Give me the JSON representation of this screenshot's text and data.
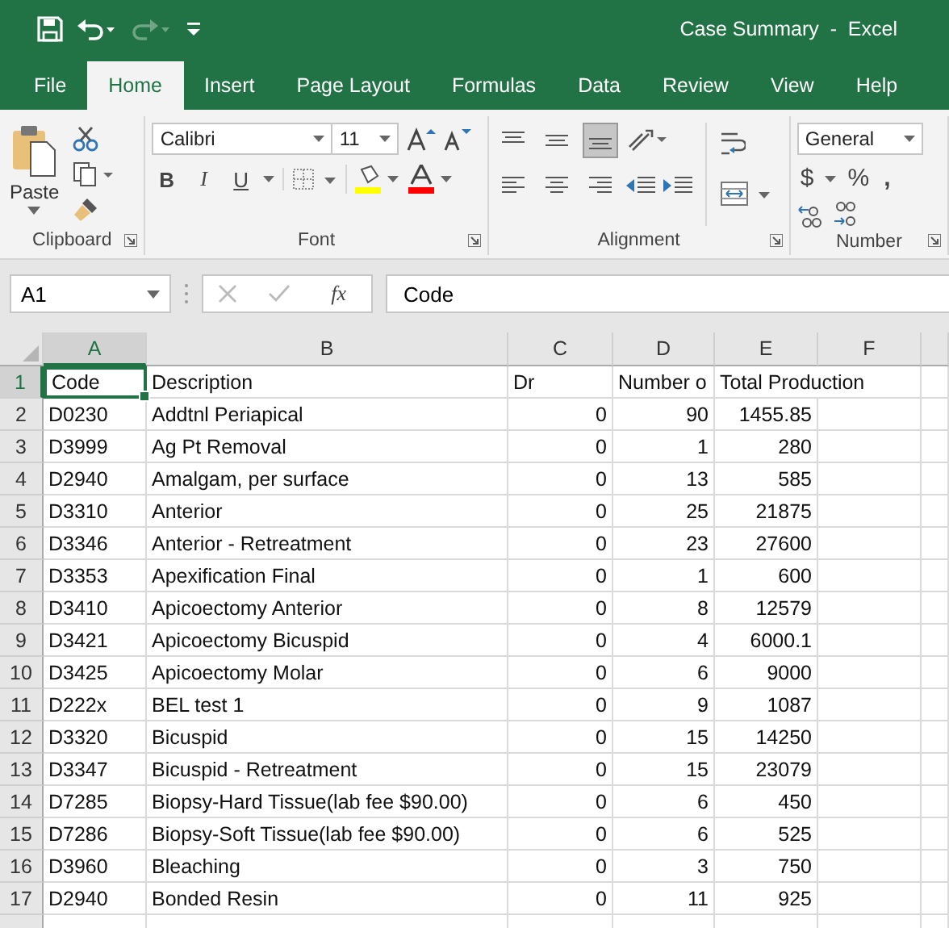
{
  "window": {
    "title": "Case Summary  -  Excel"
  },
  "tabs": [
    {
      "label": "File",
      "selected": false
    },
    {
      "label": "Home",
      "selected": true
    },
    {
      "label": "Insert",
      "selected": false
    },
    {
      "label": "Page Layout",
      "selected": false
    },
    {
      "label": "Formulas",
      "selected": false
    },
    {
      "label": "Data",
      "selected": false
    },
    {
      "label": "Review",
      "selected": false
    },
    {
      "label": "View",
      "selected": false
    },
    {
      "label": "Help",
      "selected": false
    }
  ],
  "ribbon": {
    "clipboard": {
      "label": "Clipboard",
      "paste": "Paste"
    },
    "font": {
      "label": "Font",
      "name": "Calibri",
      "size": "11",
      "bold": "B",
      "italic": "I",
      "underline": "U"
    },
    "alignment": {
      "label": "Alignment",
      "vertical": [
        {
          "kind": "top",
          "selected": false
        },
        {
          "kind": "middle",
          "selected": false
        },
        {
          "kind": "bottom",
          "selected": true
        }
      ],
      "horizontal": [
        {
          "kind": "left",
          "selected": false
        },
        {
          "kind": "center",
          "selected": false
        },
        {
          "kind": "right",
          "selected": false
        }
      ]
    },
    "number": {
      "label": "Number",
      "format": "General",
      "currency": "$",
      "percent": "%",
      "comma": ","
    }
  },
  "formula_bar": {
    "name_box": "A1",
    "fx": "fx",
    "value": "Code"
  },
  "columns": [
    {
      "label": "A",
      "selected": true
    },
    {
      "label": "B",
      "selected": false
    },
    {
      "label": "C",
      "selected": false
    },
    {
      "label": "D",
      "selected": false
    },
    {
      "label": "E",
      "selected": false
    },
    {
      "label": "F",
      "selected": false
    }
  ],
  "rows": [
    {
      "number": "1",
      "selected": true,
      "cells": [
        "Code",
        "Description",
        "Dr",
        "Number o",
        "Total Production",
        ""
      ]
    },
    {
      "number": "2",
      "selected": false,
      "cells": [
        "D0230",
        "Addtnl Periapical",
        "0",
        "90",
        "1455.85",
        ""
      ]
    },
    {
      "number": "3",
      "selected": false,
      "cells": [
        "D3999",
        "Ag Pt Removal",
        "0",
        "1",
        "280",
        ""
      ]
    },
    {
      "number": "4",
      "selected": false,
      "cells": [
        "D2940",
        "Amalgam, per surface",
        "0",
        "13",
        "585",
        ""
      ]
    },
    {
      "number": "5",
      "selected": false,
      "cells": [
        "D3310",
        "Anterior",
        "0",
        "25",
        "21875",
        ""
      ]
    },
    {
      "number": "6",
      "selected": false,
      "cells": [
        "D3346",
        "Anterior - Retreatment",
        "0",
        "23",
        "27600",
        ""
      ]
    },
    {
      "number": "7",
      "selected": false,
      "cells": [
        "D3353",
        "Apexification Final",
        "0",
        "1",
        "600",
        ""
      ]
    },
    {
      "number": "8",
      "selected": false,
      "cells": [
        "D3410",
        "Apicoectomy Anterior",
        "0",
        "8",
        "12579",
        ""
      ]
    },
    {
      "number": "9",
      "selected": false,
      "cells": [
        "D3421",
        "Apicoectomy Bicuspid",
        "0",
        "4",
        "6000.1",
        ""
      ]
    },
    {
      "number": "10",
      "selected": false,
      "cells": [
        "D3425",
        "Apicoectomy Molar",
        "0",
        "6",
        "9000",
        ""
      ]
    },
    {
      "number": "11",
      "selected": false,
      "cells": [
        "D222x",
        "BEL test 1",
        "0",
        "9",
        "1087",
        ""
      ]
    },
    {
      "number": "12",
      "selected": false,
      "cells": [
        "D3320",
        "Bicuspid",
        "0",
        "15",
        "14250",
        ""
      ]
    },
    {
      "number": "13",
      "selected": false,
      "cells": [
        "D3347",
        "Bicuspid - Retreatment",
        "0",
        "15",
        "23079",
        ""
      ]
    },
    {
      "number": "14",
      "selected": false,
      "cells": [
        "D7285",
        "Biopsy-Hard Tissue(lab fee $90.00)",
        "0",
        "6",
        "450",
        ""
      ]
    },
    {
      "number": "15",
      "selected": false,
      "cells": [
        "D7286",
        "Biopsy-Soft Tissue(lab fee $90.00)",
        "0",
        "6",
        "525",
        ""
      ]
    },
    {
      "number": "16",
      "selected": false,
      "cells": [
        "D3960",
        "Bleaching",
        "0",
        "3",
        "750",
        ""
      ]
    },
    {
      "number": "17",
      "selected": false,
      "cells": [
        "D2940",
        "Bonded Resin",
        "0",
        "11",
        "925",
        ""
      ]
    }
  ]
}
